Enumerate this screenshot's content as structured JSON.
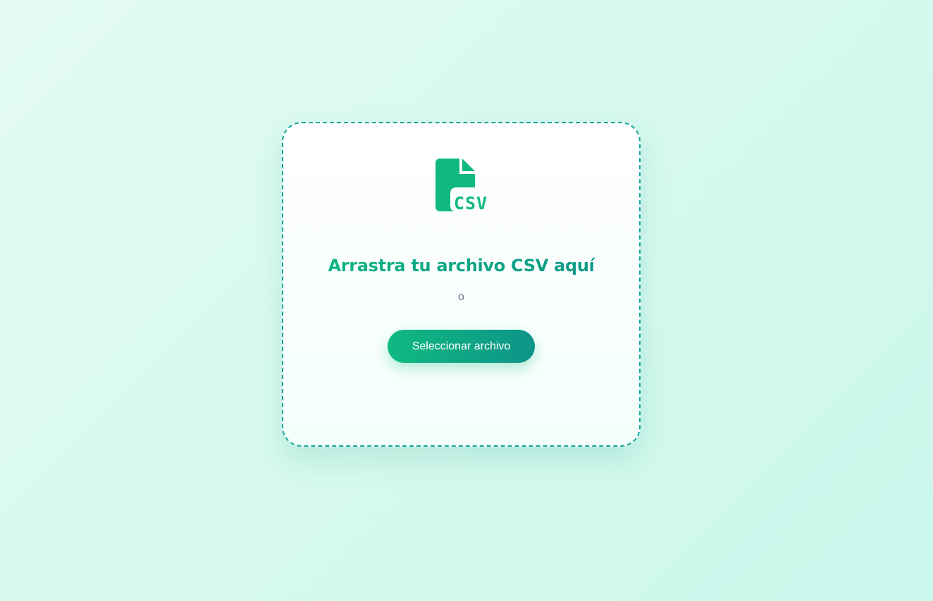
{
  "dropzone": {
    "icon": "csv-file-icon",
    "title": "Arrastra tu archivo CSV aquí",
    "separator": "o",
    "button_label": "Seleccionar archivo"
  },
  "colors": {
    "accent_start": "#10b981",
    "accent_end": "#0d9488",
    "border": "#14a89a"
  }
}
